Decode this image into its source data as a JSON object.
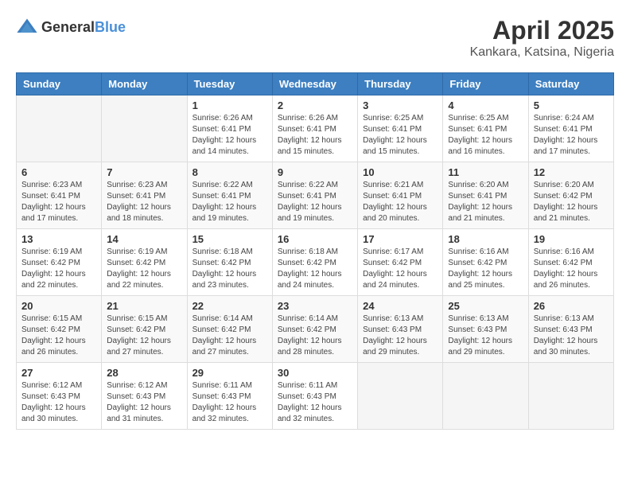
{
  "header": {
    "logo_general": "General",
    "logo_blue": "Blue",
    "main_title": "April 2025",
    "subtitle": "Kankara, Katsina, Nigeria"
  },
  "weekdays": [
    "Sunday",
    "Monday",
    "Tuesday",
    "Wednesday",
    "Thursday",
    "Friday",
    "Saturday"
  ],
  "weeks": [
    [
      {
        "day": "",
        "sunrise": "",
        "sunset": "",
        "daylight": ""
      },
      {
        "day": "",
        "sunrise": "",
        "sunset": "",
        "daylight": ""
      },
      {
        "day": "1",
        "sunrise": "Sunrise: 6:26 AM",
        "sunset": "Sunset: 6:41 PM",
        "daylight": "Daylight: 12 hours and 14 minutes."
      },
      {
        "day": "2",
        "sunrise": "Sunrise: 6:26 AM",
        "sunset": "Sunset: 6:41 PM",
        "daylight": "Daylight: 12 hours and 15 minutes."
      },
      {
        "day": "3",
        "sunrise": "Sunrise: 6:25 AM",
        "sunset": "Sunset: 6:41 PM",
        "daylight": "Daylight: 12 hours and 15 minutes."
      },
      {
        "day": "4",
        "sunrise": "Sunrise: 6:25 AM",
        "sunset": "Sunset: 6:41 PM",
        "daylight": "Daylight: 12 hours and 16 minutes."
      },
      {
        "day": "5",
        "sunrise": "Sunrise: 6:24 AM",
        "sunset": "Sunset: 6:41 PM",
        "daylight": "Daylight: 12 hours and 17 minutes."
      }
    ],
    [
      {
        "day": "6",
        "sunrise": "Sunrise: 6:23 AM",
        "sunset": "Sunset: 6:41 PM",
        "daylight": "Daylight: 12 hours and 17 minutes."
      },
      {
        "day": "7",
        "sunrise": "Sunrise: 6:23 AM",
        "sunset": "Sunset: 6:41 PM",
        "daylight": "Daylight: 12 hours and 18 minutes."
      },
      {
        "day": "8",
        "sunrise": "Sunrise: 6:22 AM",
        "sunset": "Sunset: 6:41 PM",
        "daylight": "Daylight: 12 hours and 19 minutes."
      },
      {
        "day": "9",
        "sunrise": "Sunrise: 6:22 AM",
        "sunset": "Sunset: 6:41 PM",
        "daylight": "Daylight: 12 hours and 19 minutes."
      },
      {
        "day": "10",
        "sunrise": "Sunrise: 6:21 AM",
        "sunset": "Sunset: 6:41 PM",
        "daylight": "Daylight: 12 hours and 20 minutes."
      },
      {
        "day": "11",
        "sunrise": "Sunrise: 6:20 AM",
        "sunset": "Sunset: 6:41 PM",
        "daylight": "Daylight: 12 hours and 21 minutes."
      },
      {
        "day": "12",
        "sunrise": "Sunrise: 6:20 AM",
        "sunset": "Sunset: 6:42 PM",
        "daylight": "Daylight: 12 hours and 21 minutes."
      }
    ],
    [
      {
        "day": "13",
        "sunrise": "Sunrise: 6:19 AM",
        "sunset": "Sunset: 6:42 PM",
        "daylight": "Daylight: 12 hours and 22 minutes."
      },
      {
        "day": "14",
        "sunrise": "Sunrise: 6:19 AM",
        "sunset": "Sunset: 6:42 PM",
        "daylight": "Daylight: 12 hours and 22 minutes."
      },
      {
        "day": "15",
        "sunrise": "Sunrise: 6:18 AM",
        "sunset": "Sunset: 6:42 PM",
        "daylight": "Daylight: 12 hours and 23 minutes."
      },
      {
        "day": "16",
        "sunrise": "Sunrise: 6:18 AM",
        "sunset": "Sunset: 6:42 PM",
        "daylight": "Daylight: 12 hours and 24 minutes."
      },
      {
        "day": "17",
        "sunrise": "Sunrise: 6:17 AM",
        "sunset": "Sunset: 6:42 PM",
        "daylight": "Daylight: 12 hours and 24 minutes."
      },
      {
        "day": "18",
        "sunrise": "Sunrise: 6:16 AM",
        "sunset": "Sunset: 6:42 PM",
        "daylight": "Daylight: 12 hours and 25 minutes."
      },
      {
        "day": "19",
        "sunrise": "Sunrise: 6:16 AM",
        "sunset": "Sunset: 6:42 PM",
        "daylight": "Daylight: 12 hours and 26 minutes."
      }
    ],
    [
      {
        "day": "20",
        "sunrise": "Sunrise: 6:15 AM",
        "sunset": "Sunset: 6:42 PM",
        "daylight": "Daylight: 12 hours and 26 minutes."
      },
      {
        "day": "21",
        "sunrise": "Sunrise: 6:15 AM",
        "sunset": "Sunset: 6:42 PM",
        "daylight": "Daylight: 12 hours and 27 minutes."
      },
      {
        "day": "22",
        "sunrise": "Sunrise: 6:14 AM",
        "sunset": "Sunset: 6:42 PM",
        "daylight": "Daylight: 12 hours and 27 minutes."
      },
      {
        "day": "23",
        "sunrise": "Sunrise: 6:14 AM",
        "sunset": "Sunset: 6:42 PM",
        "daylight": "Daylight: 12 hours and 28 minutes."
      },
      {
        "day": "24",
        "sunrise": "Sunrise: 6:13 AM",
        "sunset": "Sunset: 6:43 PM",
        "daylight": "Daylight: 12 hours and 29 minutes."
      },
      {
        "day": "25",
        "sunrise": "Sunrise: 6:13 AM",
        "sunset": "Sunset: 6:43 PM",
        "daylight": "Daylight: 12 hours and 29 minutes."
      },
      {
        "day": "26",
        "sunrise": "Sunrise: 6:13 AM",
        "sunset": "Sunset: 6:43 PM",
        "daylight": "Daylight: 12 hours and 30 minutes."
      }
    ],
    [
      {
        "day": "27",
        "sunrise": "Sunrise: 6:12 AM",
        "sunset": "Sunset: 6:43 PM",
        "daylight": "Daylight: 12 hours and 30 minutes."
      },
      {
        "day": "28",
        "sunrise": "Sunrise: 6:12 AM",
        "sunset": "Sunset: 6:43 PM",
        "daylight": "Daylight: 12 hours and 31 minutes."
      },
      {
        "day": "29",
        "sunrise": "Sunrise: 6:11 AM",
        "sunset": "Sunset: 6:43 PM",
        "daylight": "Daylight: 12 hours and 32 minutes."
      },
      {
        "day": "30",
        "sunrise": "Sunrise: 6:11 AM",
        "sunset": "Sunset: 6:43 PM",
        "daylight": "Daylight: 12 hours and 32 minutes."
      },
      {
        "day": "",
        "sunrise": "",
        "sunset": "",
        "daylight": ""
      },
      {
        "day": "",
        "sunrise": "",
        "sunset": "",
        "daylight": ""
      },
      {
        "day": "",
        "sunrise": "",
        "sunset": "",
        "daylight": ""
      }
    ]
  ]
}
